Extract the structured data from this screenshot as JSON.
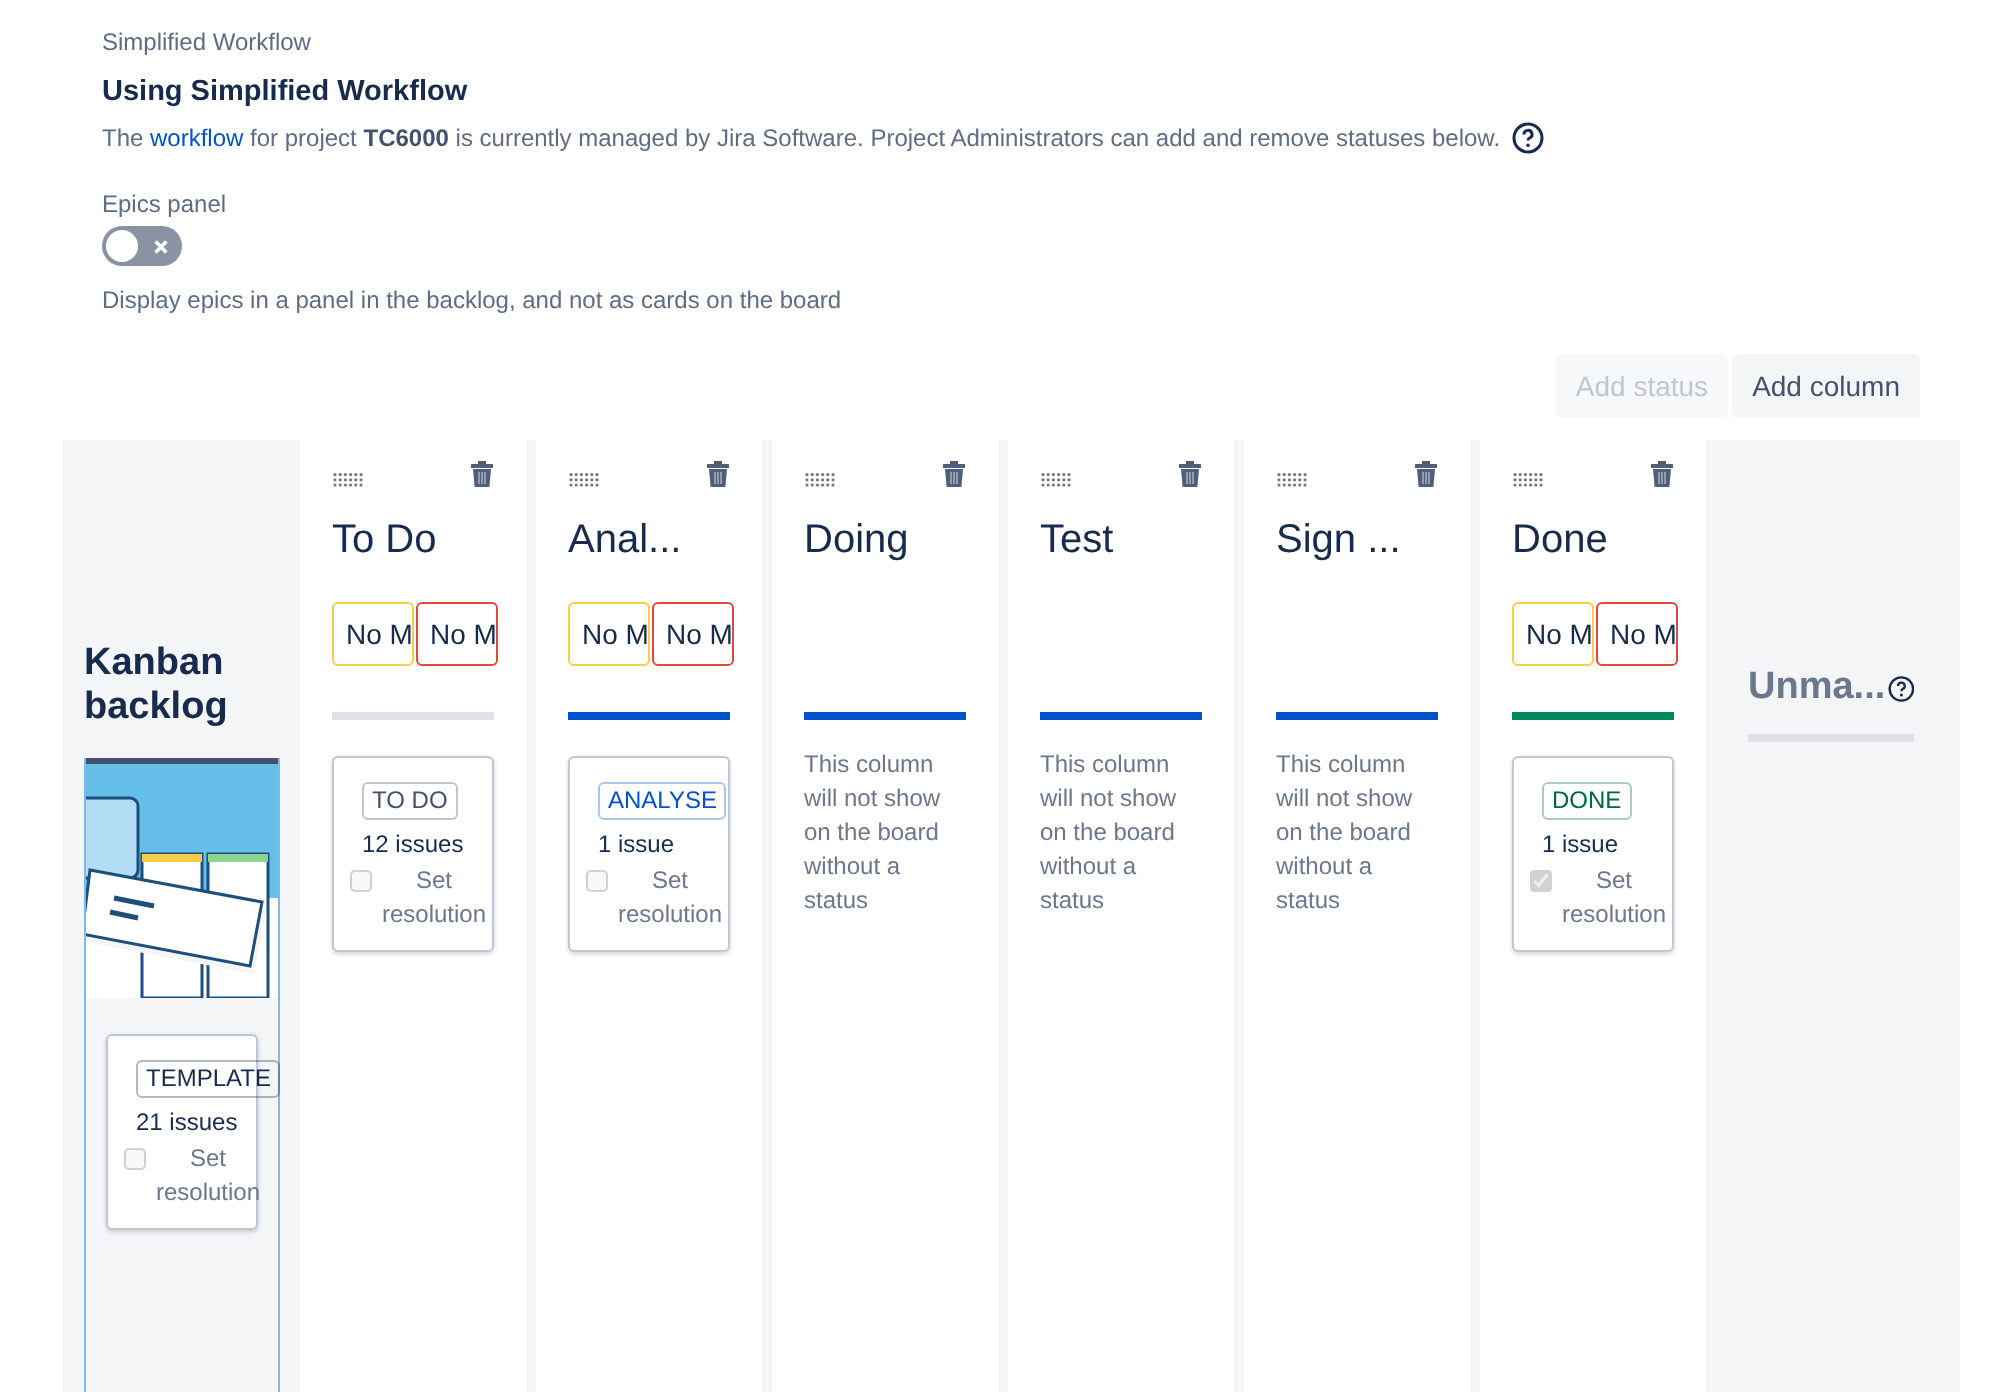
{
  "header": {
    "eyebrow": "Simplified Workflow",
    "title": "Using Simplified Workflow",
    "link": "workflow",
    "description_before": "The ",
    "description_after": " for project **TC6000** is currently managed by Jira Software. Project Administrators can add and remove statuses below."
  },
  "epics_panel": {
    "label": "Epics panel",
    "on": false,
    "hint": "Display epics in a panel in the backlog, and not as cards on the board"
  },
  "actions": [
    {
      "label": "Add status",
      "disabled": true
    },
    {
      "label": "Add column",
      "disabled": false
    }
  ],
  "backlog": {
    "title": "Kanban backlog",
    "status": {
      "lozenge": "TEMPLATE",
      "color": "#172b4d",
      "count": "21 issues",
      "checkbox_label": "Set resolution",
      "checked": false
    }
  },
  "columns": [
    {
      "kind": "status",
      "title": "To Do",
      "min": "No M",
      "max": "No M",
      "color": "#dfe1e6",
      "status": {
        "lozenge": "TO DO",
        "color": "#42526e",
        "count": "12 issues",
        "checkbox_label": "Set resolution",
        "checked": false
      }
    },
    {
      "kind": "status",
      "title": "Anal...",
      "min": "No M",
      "max": "No M",
      "color": "#0052cc",
      "status": {
        "lozenge": "ANALYSE",
        "color": "#0052cc",
        "count": "1 issue",
        "checkbox_label": "Set resolution",
        "checked": false
      }
    },
    {
      "kind": "empty",
      "title": "Doing",
      "color": "#0052cc",
      "note": "This column will not show on the board without a status"
    },
    {
      "kind": "empty",
      "title": "Test",
      "color": "#0052cc",
      "note": "This column will not show on the board without a status"
    },
    {
      "kind": "empty",
      "title": "Sign ...",
      "color": "#0052cc",
      "note": "This column will not show on the board without a status"
    },
    {
      "kind": "status",
      "title": "Done",
      "min": "No M",
      "max": "No M",
      "color": "#00875a",
      "status": {
        "lozenge": "DONE",
        "color": "#006644",
        "count": "1 issue",
        "checkbox_label": "Set resolution",
        "checked": true
      }
    }
  ],
  "unmapped": {
    "title": "Unma..."
  }
}
